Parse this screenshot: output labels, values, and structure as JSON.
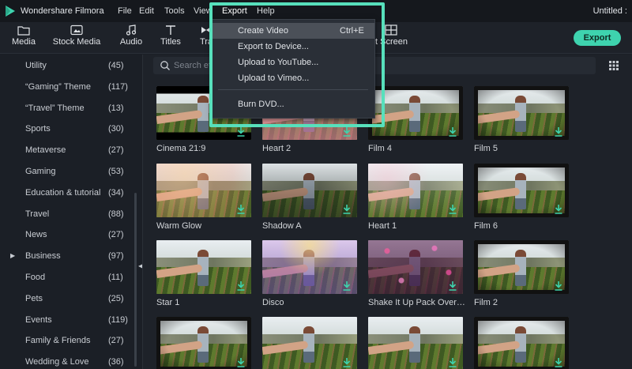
{
  "app": {
    "name": "Wondershare Filmora",
    "window_title": "Untitled :"
  },
  "menu": [
    "File",
    "Edit",
    "Tools",
    "View",
    "Export",
    "Help"
  ],
  "toolbar": {
    "items": [
      {
        "label": "Media",
        "icon": "folder-icon"
      },
      {
        "label": "Stock Media",
        "icon": "stock-media-icon"
      },
      {
        "label": "Audio",
        "icon": "music-note-icon"
      },
      {
        "label": "Titles",
        "icon": "text-t-icon"
      },
      {
        "label": "Tra",
        "icon": "transition-icon"
      },
      {
        "label": "t Screen",
        "icon": "split-screen-icon"
      }
    ],
    "export_label": "Export"
  },
  "export_menu": {
    "items": [
      {
        "label": "Create Video",
        "shortcut": "Ctrl+E",
        "highlighted": true
      },
      {
        "label": "Export to Device...",
        "shortcut": ""
      },
      {
        "label": "Upload to YouTube...",
        "shortcut": ""
      },
      {
        "label": "Upload to Vimeo...",
        "shortcut": ""
      },
      {
        "label": "Burn DVD...",
        "shortcut": ""
      }
    ]
  },
  "sidebar": {
    "categories": [
      {
        "name": "Utility",
        "count": "(45)"
      },
      {
        "name": "“Gaming” Theme",
        "count": "(117)"
      },
      {
        "name": "“Travel” Theme",
        "count": "(13)"
      },
      {
        "name": "Sports",
        "count": "(30)"
      },
      {
        "name": "Metaverse",
        "count": "(27)"
      },
      {
        "name": "Gaming",
        "count": "(53)"
      },
      {
        "name": "Education & tutorial",
        "count": "(34)"
      },
      {
        "name": "Travel",
        "count": "(88)"
      },
      {
        "name": "News",
        "count": "(27)"
      },
      {
        "name": "Business",
        "count": "(97)",
        "expandable": true
      },
      {
        "name": "Food",
        "count": "(11)"
      },
      {
        "name": "Pets",
        "count": "(25)"
      },
      {
        "name": "Events",
        "count": "(119)"
      },
      {
        "name": "Family & Friends",
        "count": "(27)"
      },
      {
        "name": "Wedding & Love",
        "count": "(36)"
      }
    ]
  },
  "search": {
    "placeholder": "Search effe"
  },
  "effects": [
    {
      "name": "Cinema 21:9",
      "style": "cinema"
    },
    {
      "name": "Heart 2",
      "style": "pink"
    },
    {
      "name": "Film 4",
      "style": "film"
    },
    {
      "name": "Film 5",
      "style": "film"
    },
    {
      "name": "Warm Glow",
      "style": "warm"
    },
    {
      "name": "Shadow A",
      "style": "shadow"
    },
    {
      "name": "Heart 1",
      "style": "heart"
    },
    {
      "name": "Film 6",
      "style": "film"
    },
    {
      "name": "Star 1",
      "style": "plain"
    },
    {
      "name": "Disco",
      "style": "disco"
    },
    {
      "name": "Shake It Up Pack Overla...",
      "style": "sparkle"
    },
    {
      "name": "Film 2",
      "style": "film"
    },
    {
      "name": "",
      "style": "film"
    },
    {
      "name": "",
      "style": "plain"
    },
    {
      "name": "",
      "style": "plain"
    },
    {
      "name": "",
      "style": "film"
    }
  ],
  "colors": {
    "accent": "#3ed3ae",
    "highlight_box": "#57e0bc",
    "download_icon": "#3ed3ae"
  }
}
